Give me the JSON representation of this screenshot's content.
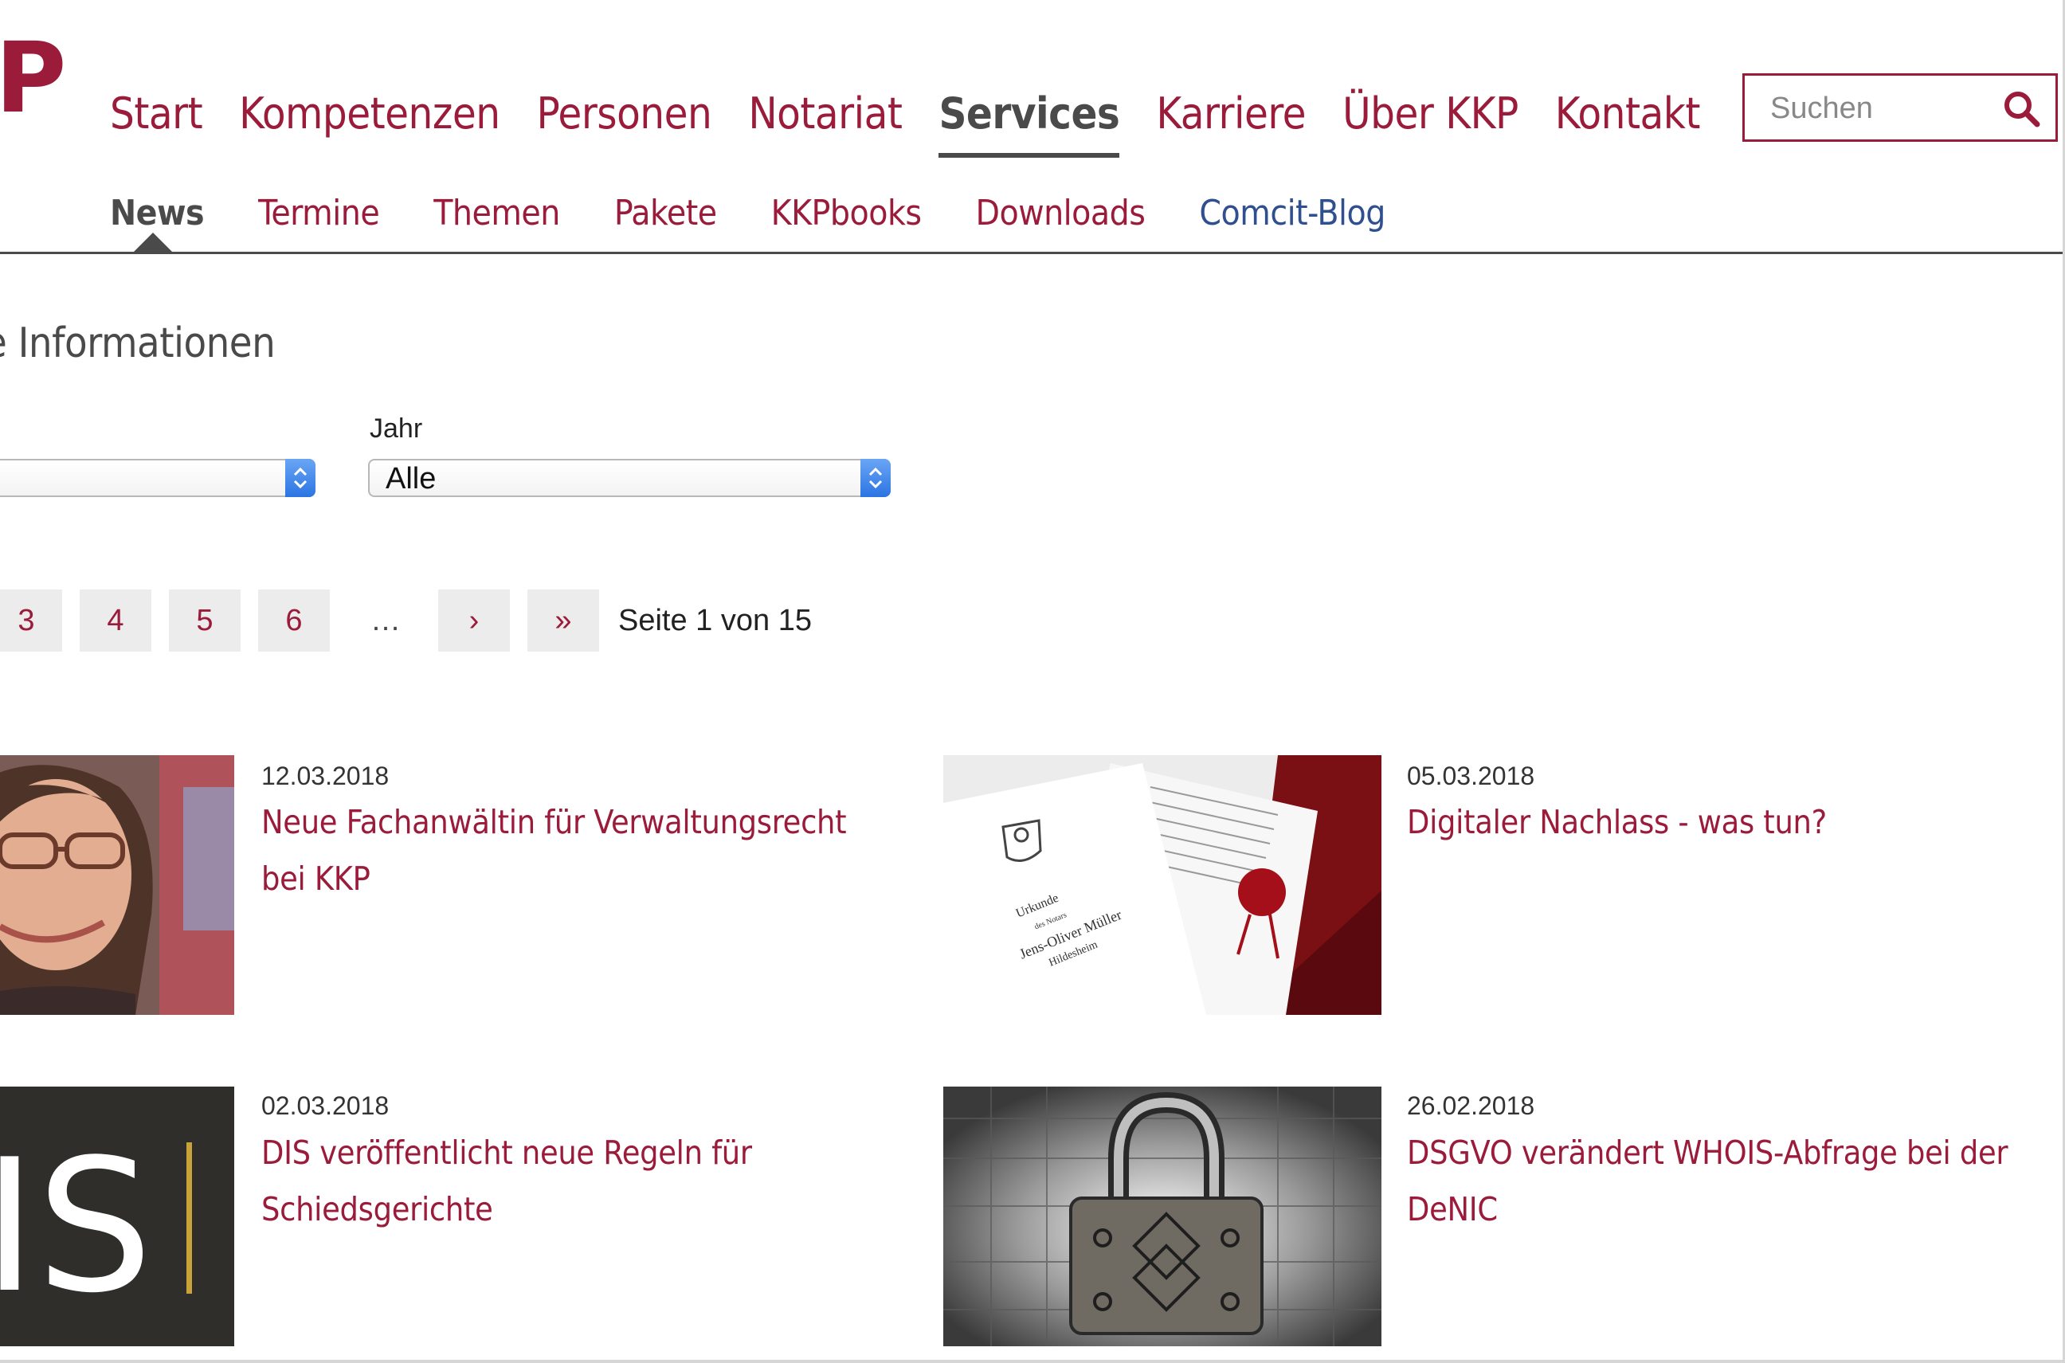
{
  "brand": {
    "logo_text": "P",
    "accent": "#9b1b3a",
    "dark": "#4a4a4a",
    "blog_color": "#2f4f8f"
  },
  "main_nav": [
    {
      "label": "Start",
      "active": false
    },
    {
      "label": "Kompetenzen",
      "active": false
    },
    {
      "label": "Personen",
      "active": false
    },
    {
      "label": "Notariat",
      "active": false
    },
    {
      "label": "Services",
      "active": true
    },
    {
      "label": "Karriere",
      "active": false
    },
    {
      "label": "Über KKP",
      "active": false
    },
    {
      "label": "Kontakt",
      "active": false
    }
  ],
  "search": {
    "placeholder": "Suchen",
    "icon": "search-icon"
  },
  "sub_nav": [
    {
      "label": "News",
      "active": true
    },
    {
      "label": "Termine"
    },
    {
      "label": "Themen"
    },
    {
      "label": "Pakete"
    },
    {
      "label": "KKPbooks"
    },
    {
      "label": "Downloads"
    },
    {
      "label": "Comcit-Blog"
    }
  ],
  "page": {
    "heading": "e Informationen",
    "filters": {
      "year_label": "Jahr",
      "year_value": "Alle"
    }
  },
  "pagination": {
    "pages": [
      "3",
      "4",
      "5",
      "6"
    ],
    "ellipsis": "…",
    "next": "›",
    "last": "»",
    "info": "Seite 1 von 15"
  },
  "news": [
    {
      "date": "12.03.2018",
      "title": "Neue Fachanwältin für Verwaltungsrecht bei KKP"
    },
    {
      "date": "05.03.2018",
      "title": "Digitaler Nachlass - was tun?"
    },
    {
      "date": "02.03.2018",
      "title": "DIS veröffentlicht neue Regeln für Schiedsgerichte"
    },
    {
      "date": "26.02.2018",
      "title": "DSGVO verändert WHOIS-Abfrage bei der DeNIC"
    }
  ],
  "images": {
    "doc_header": "Urkunde",
    "doc_sub": "des Notars",
    "doc_name": "Jens-Oliver Müller",
    "doc_city": "Hildesheim",
    "dis_letters": "IS"
  }
}
